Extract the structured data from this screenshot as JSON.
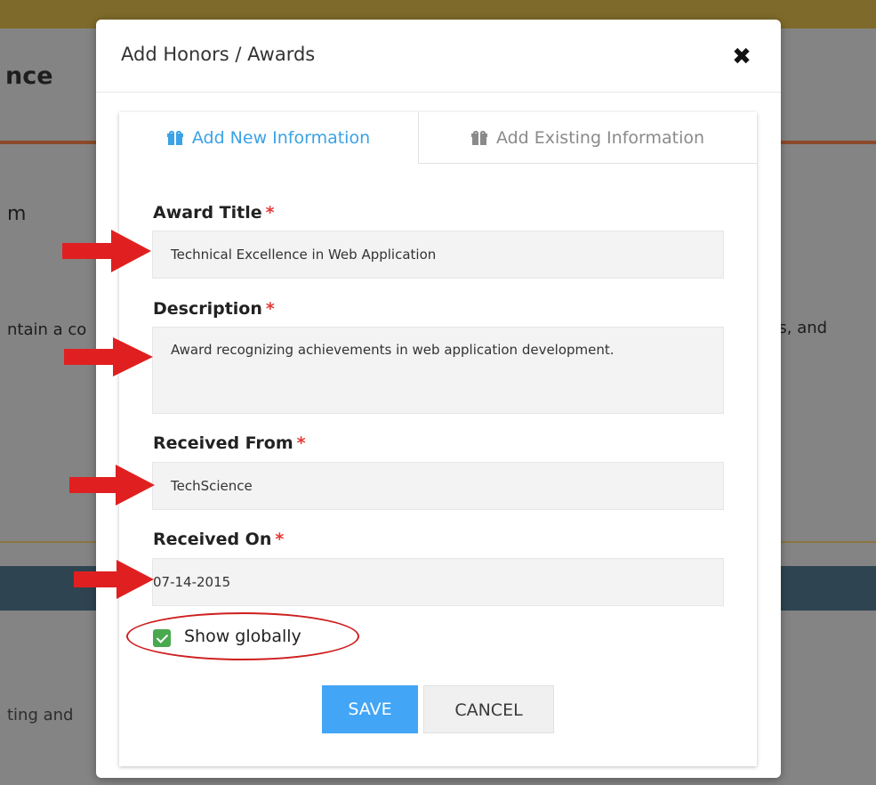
{
  "background": {
    "heading_fragment": "nce",
    "text_m": "m",
    "text_left_1": "ntain a co",
    "text_right_1": "ks, and",
    "text_left_2": "ting and"
  },
  "modal": {
    "title": "Add Honors / Awards",
    "close_glyph": "✖",
    "tabs": [
      {
        "label": "Add New Information",
        "icon": "gift-icon",
        "active": true
      },
      {
        "label": "Add Existing Information",
        "icon": "gift-icon",
        "active": false
      }
    ],
    "fields": {
      "award_title": {
        "label": "Award Title",
        "required_mark": "*",
        "value": "Technical Excellence in Web Application"
      },
      "description": {
        "label": "Description",
        "required_mark": "*",
        "value": "Award recognizing achievements in web application development."
      },
      "received_from": {
        "label": "Received From",
        "required_mark": "*",
        "value": "TechScience"
      },
      "received_on": {
        "label": "Received On",
        "required_mark": "*",
        "value": "07-14-2015"
      }
    },
    "show_globally": {
      "label": "Show globally",
      "checked": true
    },
    "buttons": {
      "save": "SAVE",
      "cancel": "CANCEL"
    }
  },
  "colors": {
    "accent": "#42a5f5",
    "active_tab": "#3aa2e6",
    "required": "#e53935",
    "checkbox": "#49a94f",
    "annotation": "#e02020"
  }
}
